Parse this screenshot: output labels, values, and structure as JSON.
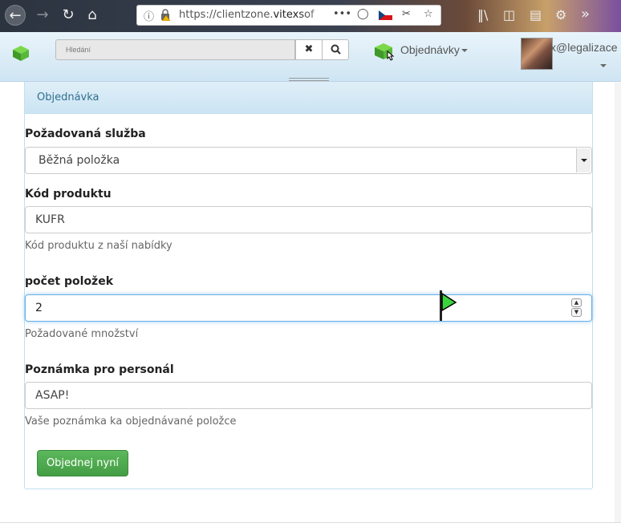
{
  "browser": {
    "back_icon": "arrow-left-icon",
    "url_prefix": "https://clientzone.",
    "url_host": "vitexsof",
    "more_icon": "•••"
  },
  "site": {
    "search_placeholder": "Hledání",
    "clear_icon": "✖",
    "search_icon": "search-icon",
    "orders_label": "Objednávky",
    "username": "x@legalizace"
  },
  "panel": {
    "title": "Objednávka"
  },
  "form": {
    "service": {
      "label": "Požadovaná služba",
      "value": "Běžná položka"
    },
    "product_code": {
      "label": "Kód produktu",
      "value": "KUFR",
      "help": "Kód produktu z naší nabídky"
    },
    "quantity": {
      "label": "počet položek",
      "value": "2",
      "help": "Požadované množství"
    },
    "note": {
      "label": "Poznámka pro personál",
      "value": "ASAP!",
      "help": "Vaše poznámka ka objednávané položce"
    },
    "submit_label": "Objednej nyní"
  },
  "colors": {
    "accent": "#31708f",
    "submit": "#449d44",
    "focus": "#66afe9"
  }
}
